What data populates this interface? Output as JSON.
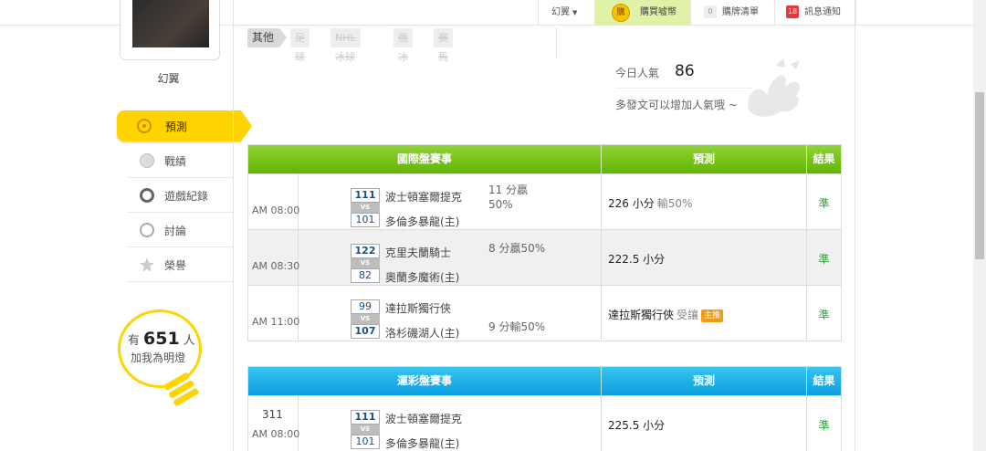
{
  "topbar": {
    "user_label": "幻翼",
    "coin_icon_text": "購",
    "coins_label": "購買嘘幣",
    "cart_count": "0",
    "cart_label": "購牌清單",
    "notify_count": "18",
    "notify_label": "訊息通知"
  },
  "sidebar": {
    "username": "幻翼",
    "active_item": "預測",
    "items": [
      {
        "label": "戰績",
        "icon": "record-icon"
      },
      {
        "label": "遊戲紀錄",
        "icon": "game-record-icon"
      },
      {
        "label": "討論",
        "icon": "discuss-icon"
      },
      {
        "label": "榮譽",
        "icon": "honor-icon"
      }
    ],
    "bulb": {
      "prefix": "有",
      "count": "651",
      "suffix": "人",
      "text": "加我為明燈"
    }
  },
  "tags": [
    {
      "label": "其他",
      "active": true
    },
    {
      "label": "足球",
      "active": false
    },
    {
      "label": "NHL冰球",
      "active": false
    },
    {
      "label": "俄冰",
      "active": false
    },
    {
      "label": "賽馬",
      "active": false
    }
  ],
  "popularity": {
    "label": "今日人氣",
    "value": "86",
    "hint": "多發文可以增加人氣哦 ~"
  },
  "colors": {
    "accent_yellow": "#ffd400",
    "green_header": "#6fc10a",
    "blue_header": "#1aa8e6",
    "win_text": "#2fa23a",
    "chip": "#f39c12"
  },
  "intl_table": {
    "headers": [
      "國際盤賽事",
      "預測",
      "結果"
    ],
    "rows": [
      {
        "time": "AM 08:00",
        "score_top": "111",
        "score_bot": "101",
        "team_top": "波士頓塞爾提克",
        "team_bot": "多倫多暴龍(主)",
        "handicap_line1": "11 分贏",
        "handicap_line2": "50%",
        "prediction": "226 小分",
        "prediction_sub": "輸50%",
        "result": "準"
      },
      {
        "time": "AM 08:30",
        "score_top": "122",
        "score_bot": "82",
        "team_top": "克里夫蘭騎士",
        "team_bot": "奧蘭多魔術(主)",
        "handicap": "8 分贏50%",
        "prediction": "222.5 小分",
        "result": "準"
      },
      {
        "time": "AM 11:00",
        "score_top": "99",
        "score_bot": "107",
        "team_top": "達拉斯獨行俠",
        "team_bot": "洛杉磯湖人(主)",
        "handicap": "9 分輸50%",
        "prediction": "達拉斯獨行俠",
        "prediction_sub": "受讓",
        "prediction_chip": "主推",
        "result": "準"
      }
    ]
  },
  "lottery_table": {
    "headers": [
      "運彩盤賽事",
      "預測",
      "結果"
    ],
    "rows": [
      {
        "number": "311",
        "time": "AM 08:00",
        "score_top": "111",
        "score_bot": "101",
        "team_top": "波士頓塞爾提克",
        "team_bot": "多倫多暴龍(主)",
        "prediction": "225.5 小分",
        "result": "準"
      }
    ],
    "vs_label": "VS"
  }
}
